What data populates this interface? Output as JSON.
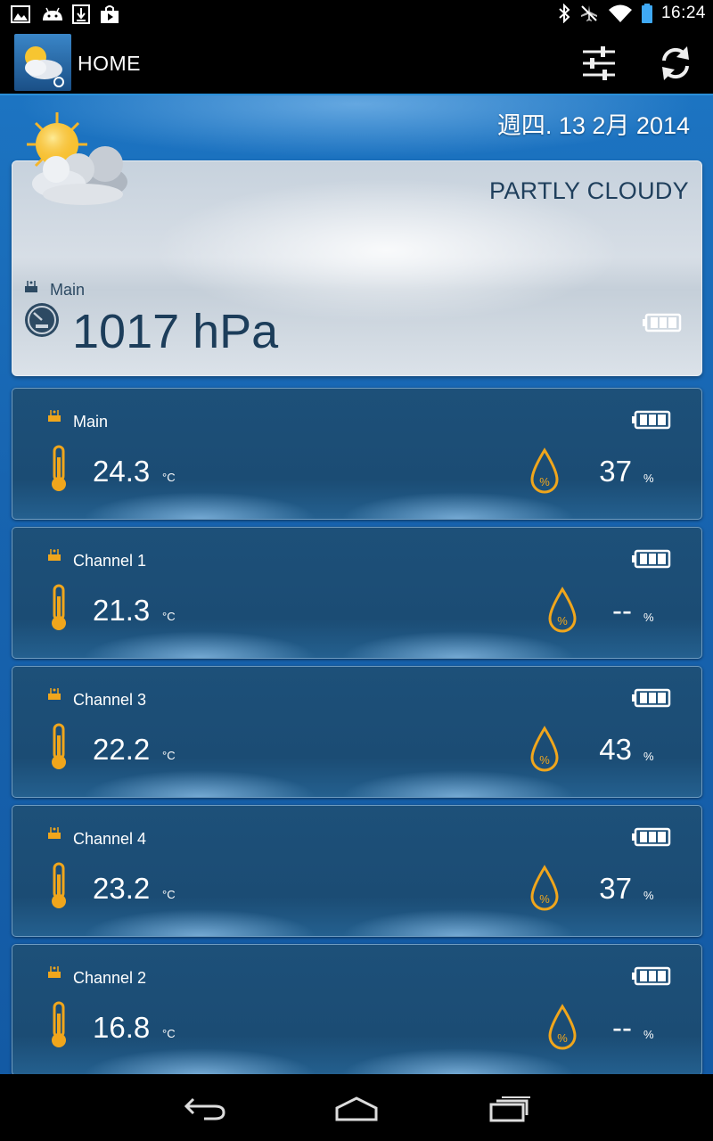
{
  "status_bar": {
    "time": "16:24",
    "left_icons": [
      "image-icon",
      "android-icon",
      "download-icon",
      "store-icon"
    ],
    "right_icons": [
      "bluetooth-icon",
      "airplane-off-icon",
      "wifi-icon",
      "battery-icon"
    ]
  },
  "action_bar": {
    "title": "HOME",
    "actions": [
      "settings-sliders-icon",
      "refresh-icon"
    ]
  },
  "header": {
    "date": "週四. 13 2月 2014"
  },
  "summary": {
    "condition": "PARTLY CLOUDY",
    "station_label": "Main",
    "pressure": "1017 hPa",
    "weather_icon": "partly-cloudy-icon"
  },
  "sensors": [
    {
      "label": "Main",
      "temp": "24.3",
      "temp_unit": "°C",
      "humidity": "37",
      "humidity_unit": "%"
    },
    {
      "label": "Channel 1",
      "temp": "21.3",
      "temp_unit": "°C",
      "humidity": "--",
      "humidity_unit": "%"
    },
    {
      "label": "Channel 3",
      "temp": "22.2",
      "temp_unit": "°C",
      "humidity": "43",
      "humidity_unit": "%"
    },
    {
      "label": "Channel 4",
      "temp": "23.2",
      "temp_unit": "°C",
      "humidity": "37",
      "humidity_unit": "%"
    },
    {
      "label": "Channel 2",
      "temp": "16.8",
      "temp_unit": "°C",
      "humidity": "--",
      "humidity_unit": "%"
    }
  ],
  "colors": {
    "accent_orange": "#f0a61c",
    "card_blue": "#1d5079",
    "background_blue": "#1764b0"
  },
  "nav_bar": [
    "back-icon",
    "home-icon",
    "recent-apps-icon"
  ]
}
